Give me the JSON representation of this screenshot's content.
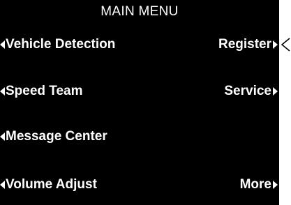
{
  "menu": {
    "title": "MAIN MENU",
    "left_items": [
      {
        "label": "Vehicle Detection"
      },
      {
        "label": "Speed Team"
      },
      {
        "label": "Message Center"
      },
      {
        "label": "Volume Adjust"
      }
    ],
    "right_items": [
      {
        "label": "Register"
      },
      {
        "label": "Service"
      },
      {
        "label": "More"
      }
    ]
  },
  "colors": {
    "screen_background": "#000000",
    "text": "#ffffff",
    "page_background": "#ffffff",
    "pointer": "#000000"
  },
  "icons": {
    "left_arrow": "triangle-left-icon",
    "right_arrow": "triangle-right-icon",
    "pointer": "caret-left-icon"
  }
}
